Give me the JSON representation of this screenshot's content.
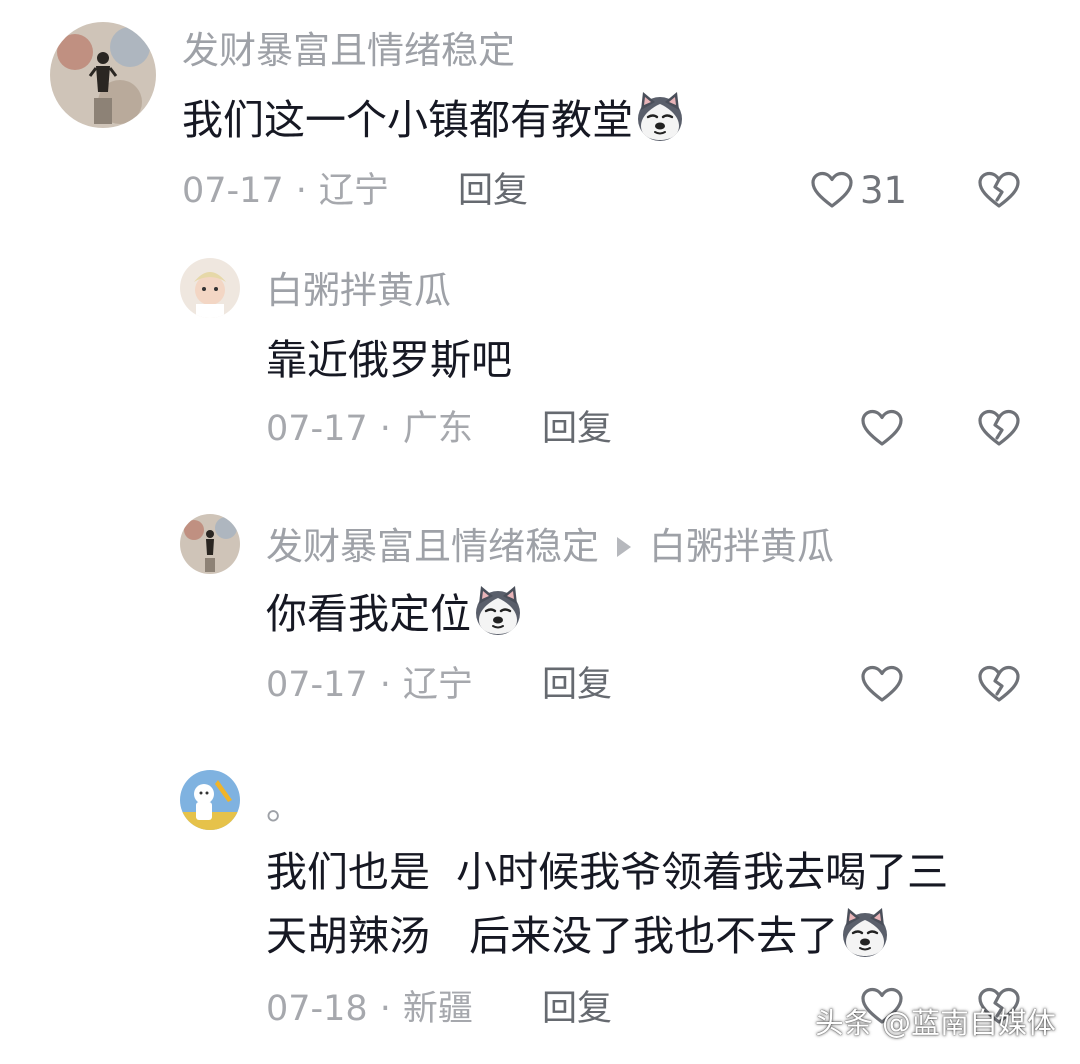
{
  "comments": [
    {
      "username": "发财暴富且情绪稳定",
      "text_lines": [
        "我们这一个小镇都有教堂"
      ],
      "emoji": "husky-dog-emoji",
      "date": "07-17",
      "separator": "·",
      "location": "辽宁",
      "reply_label": "回复",
      "like_count": "31"
    },
    {
      "username": "白粥拌黄瓜",
      "text_lines": [
        "靠近俄罗斯吧"
      ],
      "date": "07-17",
      "separator": "·",
      "location": "广东",
      "reply_label": "回复"
    },
    {
      "username": "发财暴富且情绪稳定",
      "reply_to": "白粥拌黄瓜",
      "text_lines": [
        "你看我定位"
      ],
      "emoji": "husky-dog-emoji",
      "date": "07-17",
      "separator": "·",
      "location": "辽宁",
      "reply_label": "回复"
    },
    {
      "username": "。",
      "text_lines": [
        "我们也是  小时候我爷领着我去喝了三",
        "天胡辣汤   后来没了我也不去了"
      ],
      "emoji": "husky-dog-emoji",
      "date": "07-18",
      "separator": "·",
      "location": "新疆",
      "reply_label": "回复"
    }
  ],
  "icons": {
    "like": "heart-outline-icon",
    "dislike": "broken-heart-icon"
  },
  "watermark": "头条 @蓝南自媒体",
  "colors": {
    "text": "#161823",
    "username": "#9ea1a7",
    "meta": "#a6a8ad",
    "icon": "#6f7278"
  }
}
